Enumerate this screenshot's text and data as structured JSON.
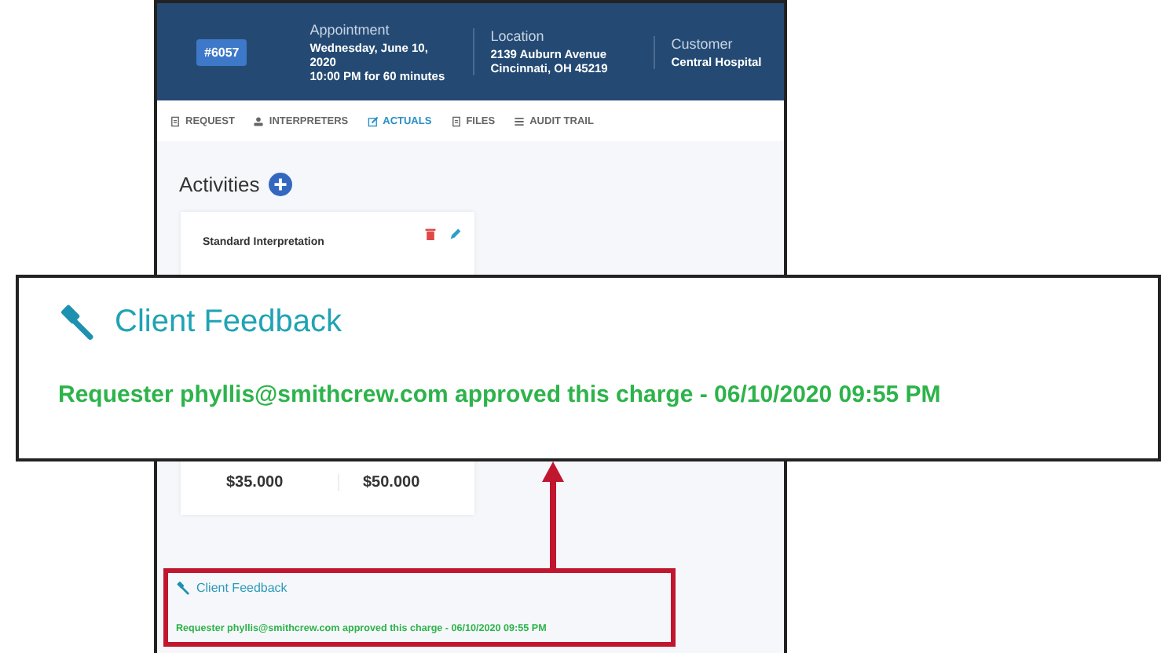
{
  "header": {
    "badge": "#6057",
    "columns": [
      {
        "label": "Appointment",
        "lines": [
          "Wednesday, June 10, 2020",
          "10:00 PM for 60 minutes"
        ]
      },
      {
        "label": "Location",
        "lines": [
          "2139 Auburn Avenue",
          "Cincinnati, OH 45219"
        ]
      },
      {
        "label": "Customer",
        "lines": [
          "Central Hospital"
        ]
      }
    ]
  },
  "tabs": [
    {
      "label": "REQUEST",
      "selected": false
    },
    {
      "label": "INTERPRETERS",
      "selected": false
    },
    {
      "label": "ACTUALS",
      "selected": true
    },
    {
      "label": "FILES",
      "selected": false
    },
    {
      "label": "AUDIT TRAIL",
      "selected": false
    }
  ],
  "activities": {
    "title": "Activities",
    "card": {
      "title": "Standard Interpretation",
      "amounts": [
        "$35.000",
        "$50.000"
      ]
    }
  },
  "feedback": {
    "title": "Client Feedback",
    "message": "Requester phyllis@smithcrew.com approved this charge - 06/10/2020 09:55 PM"
  },
  "callout": {
    "title": "Client Feedback",
    "message": "Requester phyllis@smithcrew.com approved this charge - 06/10/2020 09:55 PM"
  }
}
